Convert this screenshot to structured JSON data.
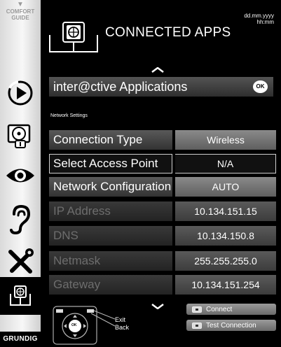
{
  "sidebar": {
    "guide_line1": "COMFORT",
    "guide_line2": "GUIDE",
    "items": [
      {
        "icon": "play-icon"
      },
      {
        "icon": "media-disc-icon"
      },
      {
        "icon": "eye-icon"
      },
      {
        "icon": "ear-icon"
      },
      {
        "icon": "tools-icon"
      },
      {
        "icon": "connected-apps-icon",
        "active": true
      }
    ],
    "brand": "GRUNDIG"
  },
  "header": {
    "title": "CONNECTED APPS",
    "date": "dd.mm.yyyy",
    "time": "hh:mm"
  },
  "interactive": {
    "label": "inter@ctive Applications",
    "ok": "OK"
  },
  "network": {
    "section_label": "Network Settings",
    "rows": [
      {
        "label": "Connection Type",
        "value": "Wireless",
        "state": "active"
      },
      {
        "label": "Select Access Point",
        "value": "N/A",
        "state": "selected"
      },
      {
        "label": "Network Configuration",
        "value": "AUTO",
        "state": "active"
      },
      {
        "label": "IP Address",
        "value": "10.134.151.15",
        "state": "dim"
      },
      {
        "label": "DNS",
        "value": "10.134.150.8",
        "state": "dim"
      },
      {
        "label": "Netmask",
        "value": "255.255.255.0",
        "state": "dim"
      },
      {
        "label": "Gateway",
        "value": "10.134.151.254",
        "state": "dim"
      }
    ]
  },
  "footer": {
    "remote_ok": "OK",
    "exit": "Exit",
    "back": "Back",
    "connect": "Connect",
    "test_connection": "Test Connection"
  }
}
